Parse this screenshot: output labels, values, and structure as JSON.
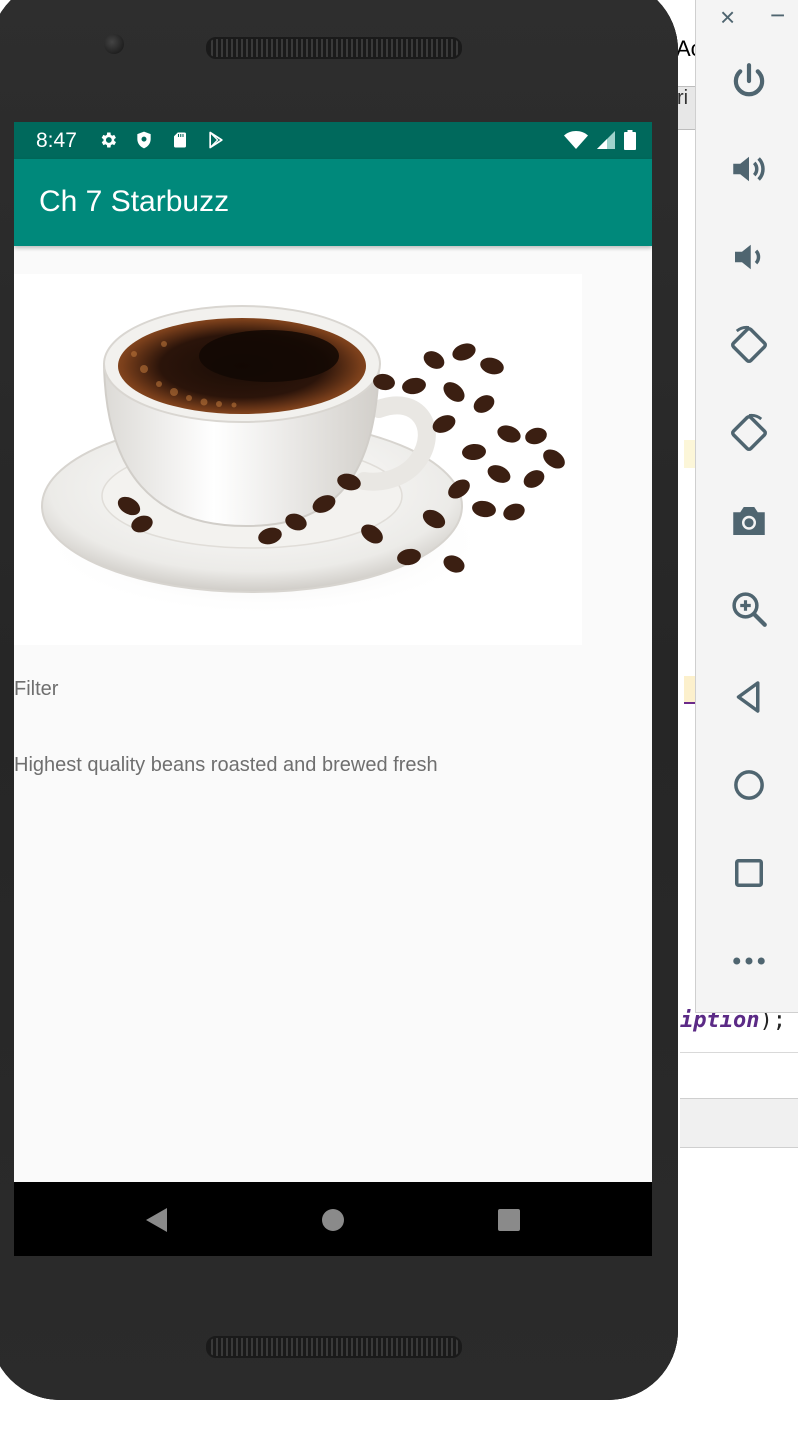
{
  "ide": {
    "top_fragment": "Ac",
    "tab_fragment": "ri",
    "code_fragment_keyword": "iption",
    "code_fragment_tail": ");"
  },
  "emulator_panel": {
    "close_glyph": "×",
    "minimize_glyph": "−",
    "tools": [
      "power",
      "volume-up",
      "volume-down",
      "rotate-left",
      "rotate-right",
      "screenshot",
      "zoom",
      "back",
      "home",
      "overview",
      "more"
    ]
  },
  "status_bar": {
    "time": "8:47",
    "left_icons": [
      "gear-icon",
      "shield-icon",
      "sd-card-icon",
      "play-store-icon"
    ],
    "right_icons": [
      "wifi-icon",
      "cell-signal-icon",
      "battery-icon"
    ]
  },
  "app_bar": {
    "title": "Ch 7 Starbuzz"
  },
  "drink": {
    "name": "Filter",
    "description": "Highest quality beans roasted and brewed fresh"
  },
  "colors": {
    "status_bar": "#00695c",
    "app_bar": "#00897b",
    "screen_bg": "#fafafa",
    "body_text": "#6f6f6f",
    "panel_icon": "#4f6570"
  }
}
